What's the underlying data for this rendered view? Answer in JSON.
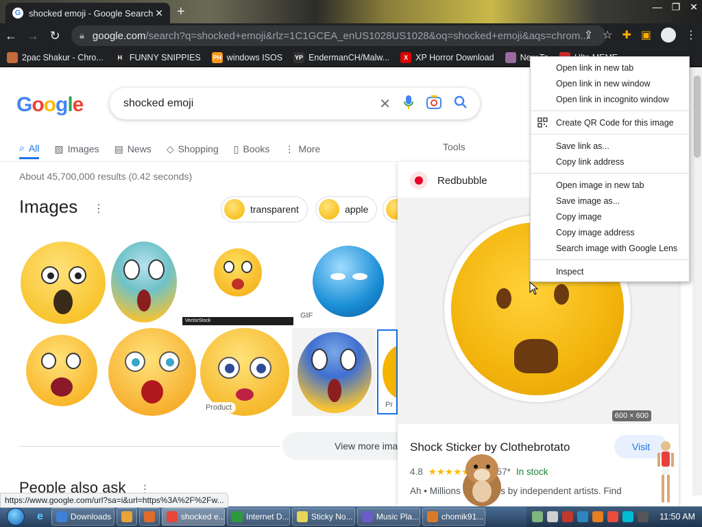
{
  "browser": {
    "tab_title": "shocked emoji - Google Search",
    "tab_close": "✕",
    "new_tab": "+",
    "url_host": "google.com",
    "url_rest": "/search?q=shocked+emoji&rlz=1C1GCEA_enUS1028US1028&oq=shocked+emoji&aqs=chrom...",
    "bookmarks": [
      {
        "label": "2pac Shakur - Chro...",
        "icon_text": "",
        "color": "#c46b3a"
      },
      {
        "label": "FUNNY SNIPPIES",
        "icon_text": "H",
        "color": "#222222"
      },
      {
        "label": "windows ISOS",
        "icon_text": "PH",
        "color": "#f7971d"
      },
      {
        "label": "EndermanCH/Malw...",
        "icon_text": "YP",
        "color": "#333333"
      },
      {
        "label": "XP Horror Download",
        "icon_text": "X",
        "color": "#e00000"
      },
      {
        "label": "New Ta",
        "icon_text": "",
        "color": "#9a6aa0"
      },
      {
        "label": "Ulta MEME",
        "icon_text": "",
        "color": "#d02a2a"
      }
    ]
  },
  "google": {
    "logo": [
      "G",
      "o",
      "o",
      "g",
      "l",
      "e"
    ],
    "logo_colors": [
      "#4285f4",
      "#ea4335",
      "#fbbc05",
      "#4285f4",
      "#34a853",
      "#ea4335"
    ],
    "query": "shocked emoji",
    "tabs": [
      "All",
      "Images",
      "News",
      "Shopping",
      "Books",
      "More"
    ],
    "tools": "Tools",
    "stats": "About 45,700,000 results (0.42 seconds)",
    "images_heading": "Images",
    "chips": [
      "transparent",
      "apple"
    ],
    "product_badge": "Product",
    "product_badge_short": "Pr",
    "gif_badge": "GIF",
    "vector_badge": "VectorStock",
    "view_more": "View more ima",
    "people_also_ask": "People also ask"
  },
  "preview": {
    "source": "Redbubble",
    "dims": "600 × 600",
    "title": "Shock Sticker by Clothebrotato",
    "visit": "Visit",
    "rating": "4.8",
    "stars": "★★★★★",
    "price": "$2.57*",
    "sep": "·",
    "stock": "In stock",
    "desc": "Ah • Millions of designs by independent artists. Find"
  },
  "context_menu": {
    "group1": [
      "Open link in new tab",
      "Open link in new window",
      "Open link in incognito window"
    ],
    "qr": "Create QR Code for this image",
    "group2": [
      "Save link as...",
      "Copy link address"
    ],
    "group3": [
      "Open image in new tab",
      "Save image as...",
      "Copy image",
      "Copy image address",
      "Search image with Google Lens"
    ],
    "inspect": "Inspect"
  },
  "status_url": "https://www.google.com/url?sa=i&url=https%3A%2F%2Fw...",
  "taskbar": {
    "items": [
      {
        "label": "Downloads",
        "color": "#3f7fd6"
      },
      {
        "label": "",
        "color": "#e8a33a"
      },
      {
        "label": "",
        "color": "#e06a2a"
      },
      {
        "label": "shocked e...",
        "color": "#e8453c"
      },
      {
        "label": "Internet D...",
        "color": "#2c9a3b"
      },
      {
        "label": "Sticky No...",
        "color": "#e6d45b"
      },
      {
        "label": "Music Pla...",
        "color": "#6b5cc7"
      },
      {
        "label": "chomik91...",
        "color": "#d97a2b"
      }
    ],
    "clock": "11:50 AM"
  }
}
